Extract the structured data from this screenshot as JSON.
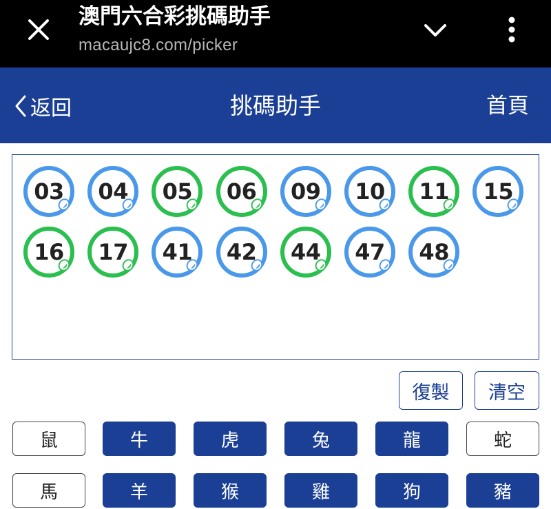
{
  "browser": {
    "title": "澳門六合彩挑碼助手",
    "url": "macaujc8.com/picker",
    "icons": {
      "close": "close-icon",
      "chevron": "chevron-down-icon",
      "more": "more-vertical-icon"
    }
  },
  "nav": {
    "back_label": "返回",
    "title": "挑碼助手",
    "home_label": "首頁"
  },
  "balls": [
    {
      "num": "03",
      "color": "blue"
    },
    {
      "num": "04",
      "color": "blue"
    },
    {
      "num": "05",
      "color": "green"
    },
    {
      "num": "06",
      "color": "green"
    },
    {
      "num": "09",
      "color": "blue"
    },
    {
      "num": "10",
      "color": "blue"
    },
    {
      "num": "11",
      "color": "green"
    },
    {
      "num": "15",
      "color": "blue"
    },
    {
      "num": "16",
      "color": "green"
    },
    {
      "num": "17",
      "color": "green"
    },
    {
      "num": "41",
      "color": "blue"
    },
    {
      "num": "42",
      "color": "blue"
    },
    {
      "num": "44",
      "color": "green"
    },
    {
      "num": "47",
      "color": "blue"
    },
    {
      "num": "48",
      "color": "blue"
    }
  ],
  "actions": {
    "copy_label": "復製",
    "clear_label": "清空"
  },
  "zodiac": [
    {
      "label": "鼠",
      "selected": false
    },
    {
      "label": "牛",
      "selected": true
    },
    {
      "label": "虎",
      "selected": true
    },
    {
      "label": "兔",
      "selected": true
    },
    {
      "label": "龍",
      "selected": true
    },
    {
      "label": "蛇",
      "selected": false
    },
    {
      "label": "馬",
      "selected": false
    },
    {
      "label": "羊",
      "selected": true
    },
    {
      "label": "猴",
      "selected": true
    },
    {
      "label": "雞",
      "selected": true
    },
    {
      "label": "狗",
      "selected": true
    },
    {
      "label": "豬",
      "selected": true
    }
  ],
  "colors": {
    "brand": "#1b3f95",
    "ball_blue": "#4a98ea",
    "ball_green": "#2bbf4f"
  }
}
